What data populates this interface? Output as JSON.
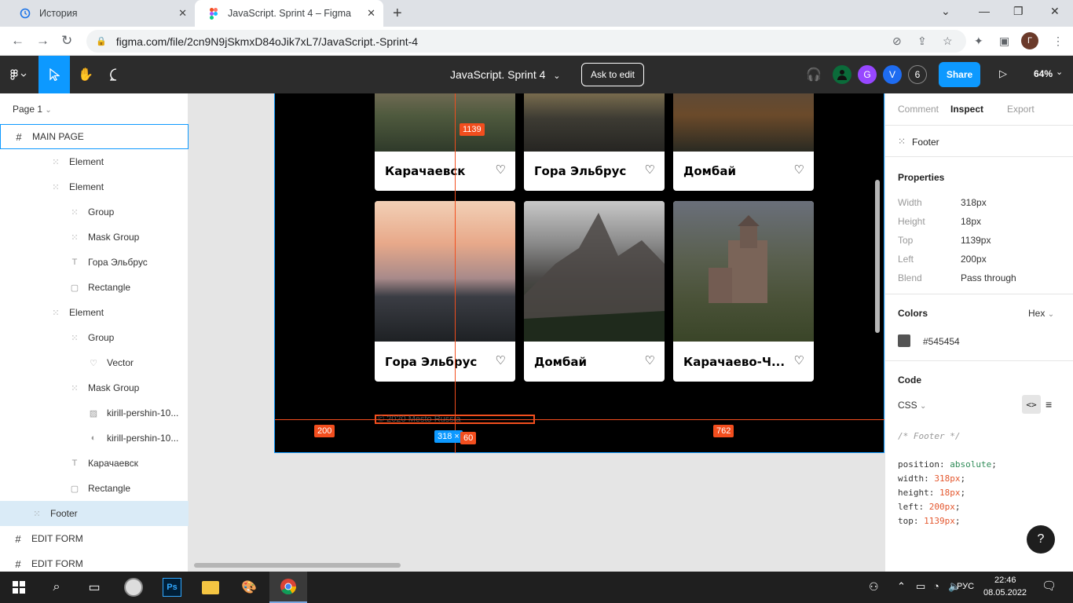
{
  "browser": {
    "tabs": [
      {
        "title": "История",
        "active": false
      },
      {
        "title": "JavaScript. Sprint 4 – Figma",
        "active": true
      }
    ],
    "url": "figma.com/file/2cn9N9jSkmxD84oJik7xL7/JavaScript.-Sprint-4",
    "profile_initial": "Г"
  },
  "figma": {
    "file_title": "JavaScript. Sprint 4",
    "ask_to_edit": "Ask to edit",
    "avatars": [
      {
        "letter": "G",
        "color": "#9747ff"
      },
      {
        "letter": "V",
        "color": "#1e6cf1"
      },
      {
        "letter": "6",
        "color": "#2c2c2c"
      }
    ],
    "share": "Share",
    "zoom": "64%"
  },
  "layers": {
    "page": "Page 1",
    "items": [
      {
        "label": "MAIN PAGE",
        "icon": "frame-icon",
        "indent": 0,
        "selected": false,
        "outlined": true
      },
      {
        "label": "Element",
        "icon": "group-icon",
        "indent": 3
      },
      {
        "label": "Element",
        "icon": "group-icon",
        "indent": 3
      },
      {
        "label": "Group",
        "icon": "group-icon",
        "indent": 4
      },
      {
        "label": "Mask Group",
        "icon": "group-icon",
        "indent": 4
      },
      {
        "label": "Гора Эльбрус",
        "icon": "text-icon",
        "indent": 4
      },
      {
        "label": "Rectangle",
        "icon": "rectangle-icon",
        "indent": 4
      },
      {
        "label": "Element",
        "icon": "group-icon",
        "indent": 3
      },
      {
        "label": "Group",
        "icon": "group-icon",
        "indent": 4
      },
      {
        "label": "Vector",
        "icon": "heart-vector-icon",
        "indent": 5
      },
      {
        "label": "Mask Group",
        "icon": "group-icon",
        "indent": 4
      },
      {
        "label": "kirill-pershin-10...",
        "icon": "image-icon",
        "indent": 5
      },
      {
        "label": "kirill-pershin-10...",
        "icon": "mask-icon",
        "indent": 5
      },
      {
        "label": "Карачаевск",
        "icon": "text-icon",
        "indent": 4
      },
      {
        "label": "Rectangle",
        "icon": "rectangle-icon",
        "indent": 4
      },
      {
        "label": "Footer",
        "icon": "group-icon",
        "indent": 2,
        "selected": true
      },
      {
        "label": "EDIT FORM",
        "icon": "frame-icon",
        "indent": 0
      },
      {
        "label": "EDIT FORM",
        "icon": "frame-icon",
        "indent": 0
      }
    ]
  },
  "canvas": {
    "cards_top": [
      {
        "title": "Карачаевск"
      },
      {
        "title": "Гора Эльбрус"
      },
      {
        "title": "Домбай"
      }
    ],
    "cards_bottom": [
      {
        "title": "Гора Эльбрус"
      },
      {
        "title": "Домбай"
      },
      {
        "title": "Карачаево-Ч..."
      }
    ],
    "footer_text": "© 2020 Mesto Russia",
    "measure_top": "1139",
    "measure_left": "200",
    "measure_right": "762",
    "measure_size_w": "318 ×",
    "measure_size_h": "60"
  },
  "inspect": {
    "tabs": [
      "Comment",
      "Inspect",
      "Export"
    ],
    "active_tab": "Inspect",
    "layer_name": "Footer",
    "properties_title": "Properties",
    "properties": [
      {
        "label": "Width",
        "value": "318px"
      },
      {
        "label": "Height",
        "value": "18px"
      },
      {
        "label": "Top",
        "value": "1139px"
      },
      {
        "label": "Left",
        "value": "200px"
      },
      {
        "label": "Blend",
        "value": "Pass through"
      }
    ],
    "colors_title": "Colors",
    "color_format": "Hex",
    "color_value": "#545454",
    "code_title": "Code",
    "code_lang": "CSS",
    "code_comment": "/* Footer */",
    "code_lines": [
      {
        "prop": "position:",
        "val": "absolute",
        "type": "kw"
      },
      {
        "prop": "width:",
        "val": "318px",
        "type": "num"
      },
      {
        "prop": "height:",
        "val": "18px",
        "type": "num"
      },
      {
        "prop": "left:",
        "val": "200px",
        "type": "num"
      },
      {
        "prop": "top:",
        "val": "1139px",
        "type": "num"
      }
    ]
  },
  "taskbar": {
    "time": "22:46",
    "date": "08.05.2022",
    "lang": "РУС"
  }
}
